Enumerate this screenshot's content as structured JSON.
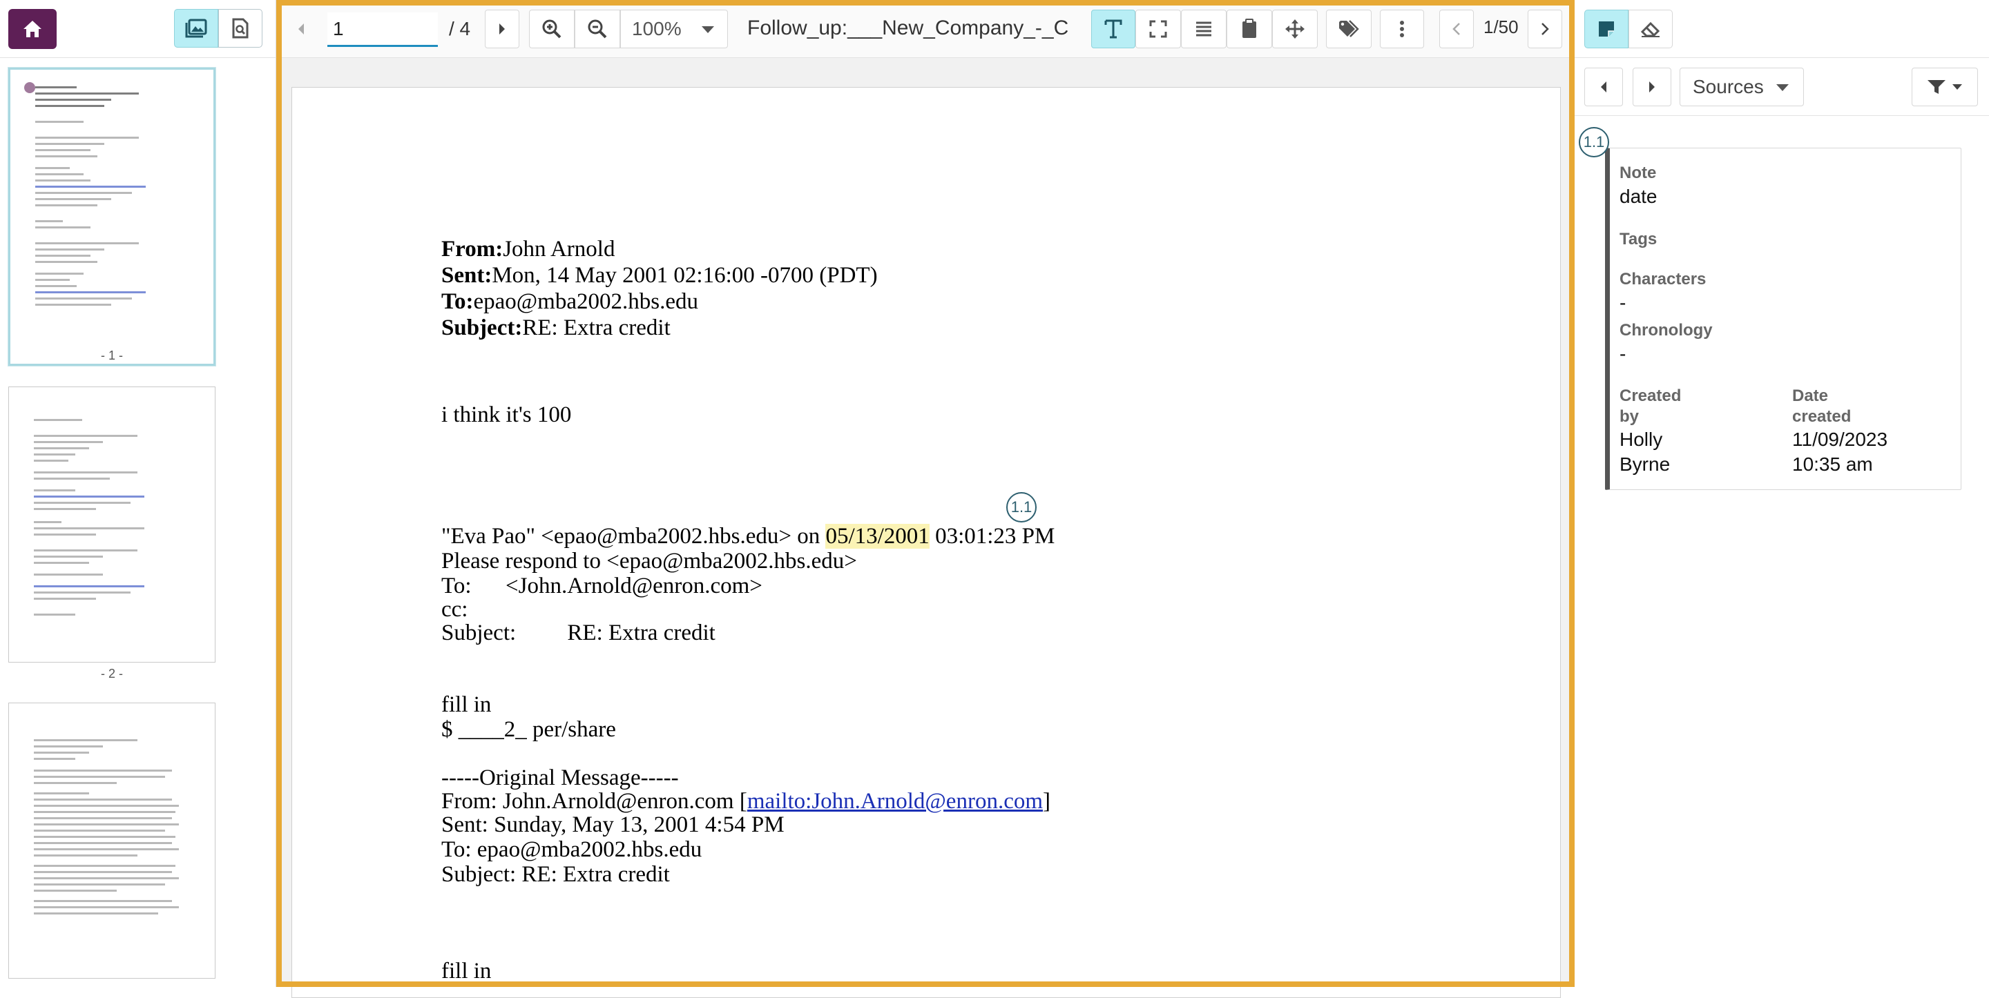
{
  "toolbar": {
    "page_current": "1",
    "page_total": "/ 4",
    "zoom": "100%",
    "doc_title": "Follow_up:___New_Company_-_C",
    "annotation_counter": "1/50"
  },
  "thumbnails": [
    {
      "label": "- 1 -"
    },
    {
      "label": "- 2 -"
    }
  ],
  "document": {
    "from_label": "From:",
    "from_value": "John Arnold",
    "sent_label": "Sent:",
    "sent_value": "Mon, 14 May 2001 02:16:00 -0700 (PDT)",
    "to_label": "To:",
    "to_value": "epao@mba2002.hbs.edu",
    "subject_label": "Subject:",
    "subject_value": "RE: Extra credit",
    "body1": "i think it's 100",
    "quote_pre": "\"Eva Pao\" <epao@mba2002.hbs.edu> on ",
    "quote_date": "05/13/2001",
    "quote_post": " 03:01:23 PM",
    "respond": "Please respond to <epao@mba2002.hbs.edu>",
    "to_line": "To:      <John.Arnold@enron.com>",
    "cc_line": "cc:",
    "subject_line": "Subject:         RE: Extra credit",
    "fill_in": "fill in",
    "per_share": "$ ____2_ per/share",
    "orig_msg": "-----Original Message-----",
    "orig_from_pre": "From: John.Arnold@enron.com [",
    "orig_from_link": "mailto:John.Arnold@enron.com",
    "orig_from_post": "]",
    "orig_sent": "Sent: Sunday, May 13, 2001 4:54 PM",
    "orig_to": "To: epao@mba2002.hbs.edu",
    "orig_subject": "Subject: RE: Extra credit",
    "fill_in_2": "fill in"
  },
  "marker_label": "1.1",
  "right_panel": {
    "sources_label": "Sources",
    "card_marker": "1.1",
    "note_label": "Note",
    "note_value": "date",
    "tags_label": "Tags",
    "characters_label": "Characters",
    "characters_value": "-",
    "chronology_label": "Chronology",
    "chronology_value": "-",
    "created_by_label_1": "Created",
    "created_by_label_2": "by",
    "created_by_value_1": "Holly",
    "created_by_value_2": "Byrne",
    "date_created_label_1": "Date",
    "date_created_label_2": "created",
    "date_created_value_1": "11/09/2023",
    "date_created_value_2": "10:35 am"
  },
  "colors": {
    "accent": "#e7a935",
    "home_bg": "#5e1f56",
    "active_bg": "#b8eef5",
    "highlight": "#fbf3b5",
    "link": "#1a2fb5"
  },
  "icons": [
    "home-icon",
    "thumbnails-icon",
    "search-document-icon",
    "chevron-left-icon",
    "chevron-right-icon",
    "zoom-in-icon",
    "zoom-out-icon",
    "chevron-down-icon",
    "text-tool-icon",
    "fullscreen-icon",
    "align-icon",
    "clipboard-icon",
    "move-icon",
    "tag-icon",
    "more-vertical-icon",
    "note-icon",
    "eraser-icon",
    "filter-icon"
  ]
}
